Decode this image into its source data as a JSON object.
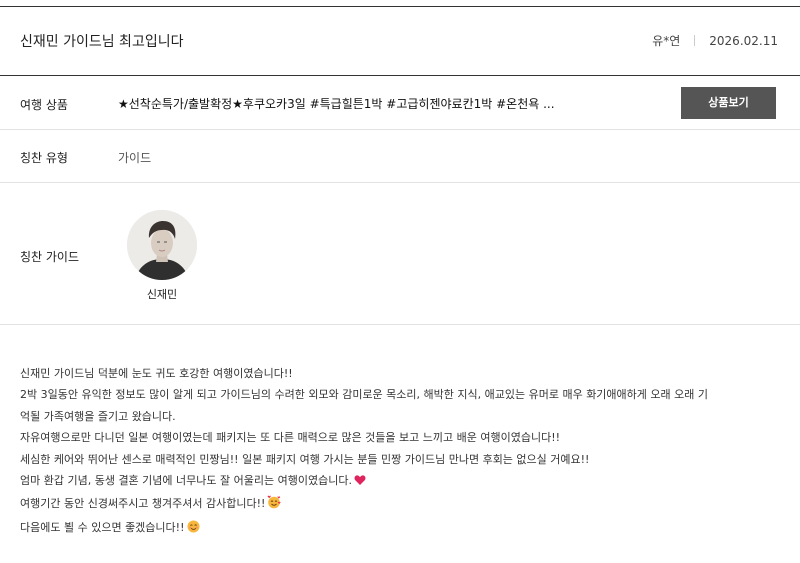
{
  "post": {
    "title": "신재민 가이드님 최고입니다",
    "author": "유*연",
    "date": "2026.02.11"
  },
  "product": {
    "label": "여행 상품",
    "name": "★선착순특가/출발확정★후쿠오카3일 #특급힐튼1박 #고급히젠야료칸1박 #온천욕 ...",
    "button_label": "상품보기"
  },
  "praise_type": {
    "label": "칭찬 유형",
    "value": "가이드"
  },
  "praise_guide": {
    "label": "칭찬 가이드",
    "name": "신재민"
  },
  "review": {
    "lines": [
      "신재민 가이드님 덕분에 눈도 귀도 호강한 여행이였습니다!!",
      "2박 3일동안 유익한 정보도 많이 알게 되고 가이드님의 수려한 외모와 감미로운 목소리, 해박한 지식, 애교있는 유머로 매우 화기애애하게 오래 오래 기",
      "억될 가족여행을 즐기고 왔습니다.",
      "자유여행으로만 다니던 일본 여행이였는데 패키지는 또 다른 매력으로 많은 것들을 보고 느끼고 배운 여행이였습니다!!",
      "세심한 케어와 뛰어난 센스로 매력적인 민짱님!! 일본 패키지 여행 가시는 분들 민짱 가이드님 만나면 후회는 없으실 거예요!!",
      "엄마 환갑 기념, 동생 결혼 기념에 너무나도 잘 어울리는 여행이였습니다.",
      "여행기간 동안 신경써주시고 챙겨주셔서 감사합니다!!",
      "다음에도 뵐 수 있으면 좋겠습니다!!"
    ]
  },
  "icons": {
    "heart": "heart-icon",
    "smiling_face_with_hearts": "smiling-face-with-hearts-icon",
    "smiling_face": "smiling-face-icon"
  },
  "colors": {
    "button_bg": "#555555",
    "heart": "#e0245e"
  }
}
